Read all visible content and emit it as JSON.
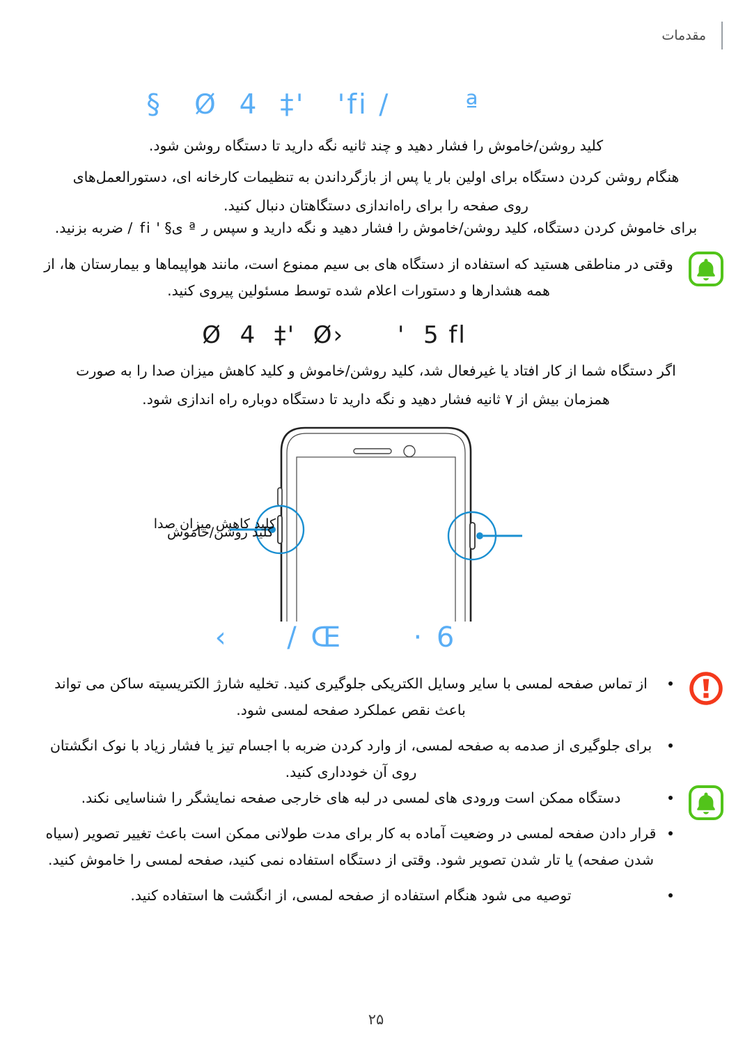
{
  "header": {
    "title": "مقدمات"
  },
  "headings": {
    "power_on_off": "Ø  4  ‡'   'fi /       ª   §",
    "restart": "Ø  4  ‡'  Ø›      '  5 fl",
    "touchscreen": "6 ·      Œ /     ›"
  },
  "colors": {
    "heading_blue": "#5aaef5",
    "note_green": "#52c41a",
    "caution_red": "#f4391c",
    "callout_blue": "#1a8fd1",
    "header_rule": "#9aa0a6",
    "text": "#111111"
  },
  "body": {
    "power_on": "کلید روشن/خاموش را فشار دهید و چند ثانیه نگه دارید تا دستگاه روشن شود.",
    "first_setup": "هنگام روشن کردن دستگاه برای اولین بار یا پس از بازگرداندن به تنظیمات کارخانه ای، دستورالعمل‌های روی صفحه را برای راه‌اندازی دستگاهتان دنبال کنید.",
    "power_off_prefix": "برای خاموش کردن دستگاه، کلید روشن/خاموش را فشار دهید و نگه دارید و سپس ر",
    "power_off_glyph": "ª ی§    ' fi /",
    "power_off_suffix": "ضربه بزنید.",
    "restart": "اگر دستگاه شما از کار افتاد یا غیرفعال شد، کلید روشن/خاموش و کلید کاهش میزان صدا را به صورت همزمان بیش از ۷ ثانیه فشار دهید و نگه دارید تا دستگاه دوباره راه اندازی شود."
  },
  "notes": {
    "wireless": {
      "icon": "bell-icon",
      "text": "وقتی در مناطقی هستید که استفاده از دستگاه های بی سیم ممنوع است، مانند هواپیماها و بیمارستان ها، از همه هشدارها و دستورات اعلام شده توسط مسئولین پیروی کنید."
    },
    "touchscreen": {
      "icon": "bell-icon",
      "items": [
        "دستگاه ممکن است ورودی های لمسی در لبه های خارجی صفحه نمایشگر را شناسایی نکند.",
        "قرار دادن صفحه لمسی در وضعیت آماده به کار برای مدت طولانی ممکن است باعث تغییر تصویر (سیاه شدن صفحه) یا تار شدن تصویر شود. وقتی از دستگاه استفاده نمی کنید، صفحه لمسی را خاموش کنید.",
        "توصیه می شود هنگام استفاده از صفحه لمسی، از انگشت ها استفاده کنید."
      ]
    }
  },
  "caution": {
    "icon": "warning-icon",
    "items": [
      "از تماس صفحه لمسی با سایر وسایل الکتریکی جلوگیری کنید. تخلیه شارژ الکتریسیته ساکن می تواند باعث نقص عملکرد صفحه لمسی شود.",
      "برای جلوگیری از صدمه به صفحه لمسی، از وارد کردن ضربه با اجسام تیز یا فشار زیاد با نوک انگشتان روی آن خودداری کنید."
    ]
  },
  "figure": {
    "alt": "phone-front-illustration",
    "callouts": {
      "volume_down": "کلید کاهش میزان صدا",
      "power_key": "کلید روشن/خاموش"
    }
  },
  "footer": {
    "page_number": "۲۵"
  }
}
